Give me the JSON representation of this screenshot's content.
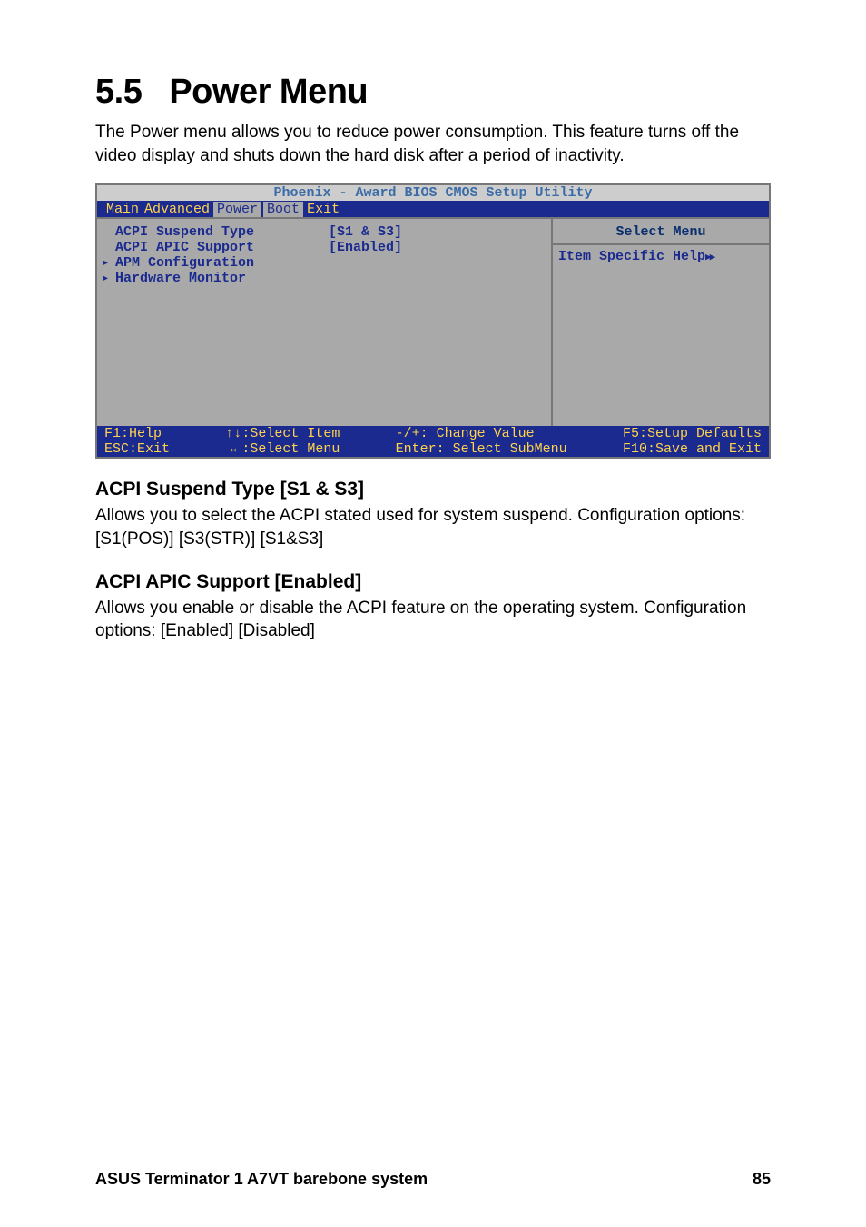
{
  "section": {
    "number": "5.5",
    "title": "Power Menu"
  },
  "intro": "The Power menu allows you to reduce power consumption. This feature turns off the video display and shuts down the hard disk after a period of inactivity.",
  "bios": {
    "header": "Phoenix - Award BIOS CMOS Setup Utility",
    "tabs": [
      "Main",
      "Advanced",
      "Power",
      "Boot",
      "Exit"
    ],
    "active_tab": "Power",
    "items": [
      {
        "label": "ACPI Suspend Type",
        "value": "[S1 & S3]",
        "submenu": false
      },
      {
        "label": "ACPI APIC Support",
        "value": "[Enabled]",
        "submenu": false
      },
      {
        "label": "APM Configuration",
        "value": "",
        "submenu": true
      },
      {
        "label": "Hardware Monitor",
        "value": "",
        "submenu": true
      }
    ],
    "right": {
      "header": "Select Menu",
      "help": "Item Specific Help"
    },
    "footer": {
      "c1a": "F1:Help",
      "c1b": "ESC:Exit",
      "c2a": "↑↓:Select Item",
      "c2b": "→←:Select Menu",
      "c3a": "-/+: Change Value",
      "c3b": "Enter: Select SubMenu",
      "c4a": "F5:Setup Defaults",
      "c4b": "F10:Save and Exit"
    }
  },
  "settings": [
    {
      "heading": "ACPI Suspend Type [S1 & S3]",
      "body": "Allows you to select the ACPI stated used for system suspend. Configuration options: [S1(POS)] [S3(STR)] [S1&S3]"
    },
    {
      "heading": "ACPI APIC Support [Enabled]",
      "body": "Allows you enable or disable the ACPI feature on the operating system. Configuration options: [Enabled] [Disabled]"
    }
  ],
  "footer": {
    "left": "ASUS Terminator 1 A7VT barebone system",
    "right": "85"
  }
}
